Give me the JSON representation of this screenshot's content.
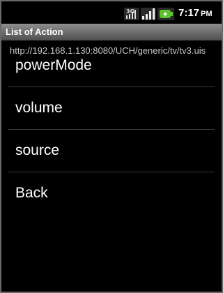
{
  "status_bar": {
    "network_label": "3G",
    "time": "7:17",
    "ampm": "PM",
    "icons": [
      "3g-icon",
      "signal-bars-icon",
      "battery-icon"
    ]
  },
  "title_bar": {
    "title": "List of Action"
  },
  "url": "http://192.168.1.130:8080/UCH/generic/tv/tv3.uis",
  "actions": [
    {
      "label": "powerMode"
    },
    {
      "label": "volume"
    },
    {
      "label": "source"
    },
    {
      "label": "Back"
    }
  ],
  "colors": {
    "background": "#000000",
    "title_bar_top": "#8e8e8e",
    "title_bar_bottom": "#4e4e4e",
    "divider": "#3c3c3c",
    "battery_green": "#5cc12f"
  }
}
